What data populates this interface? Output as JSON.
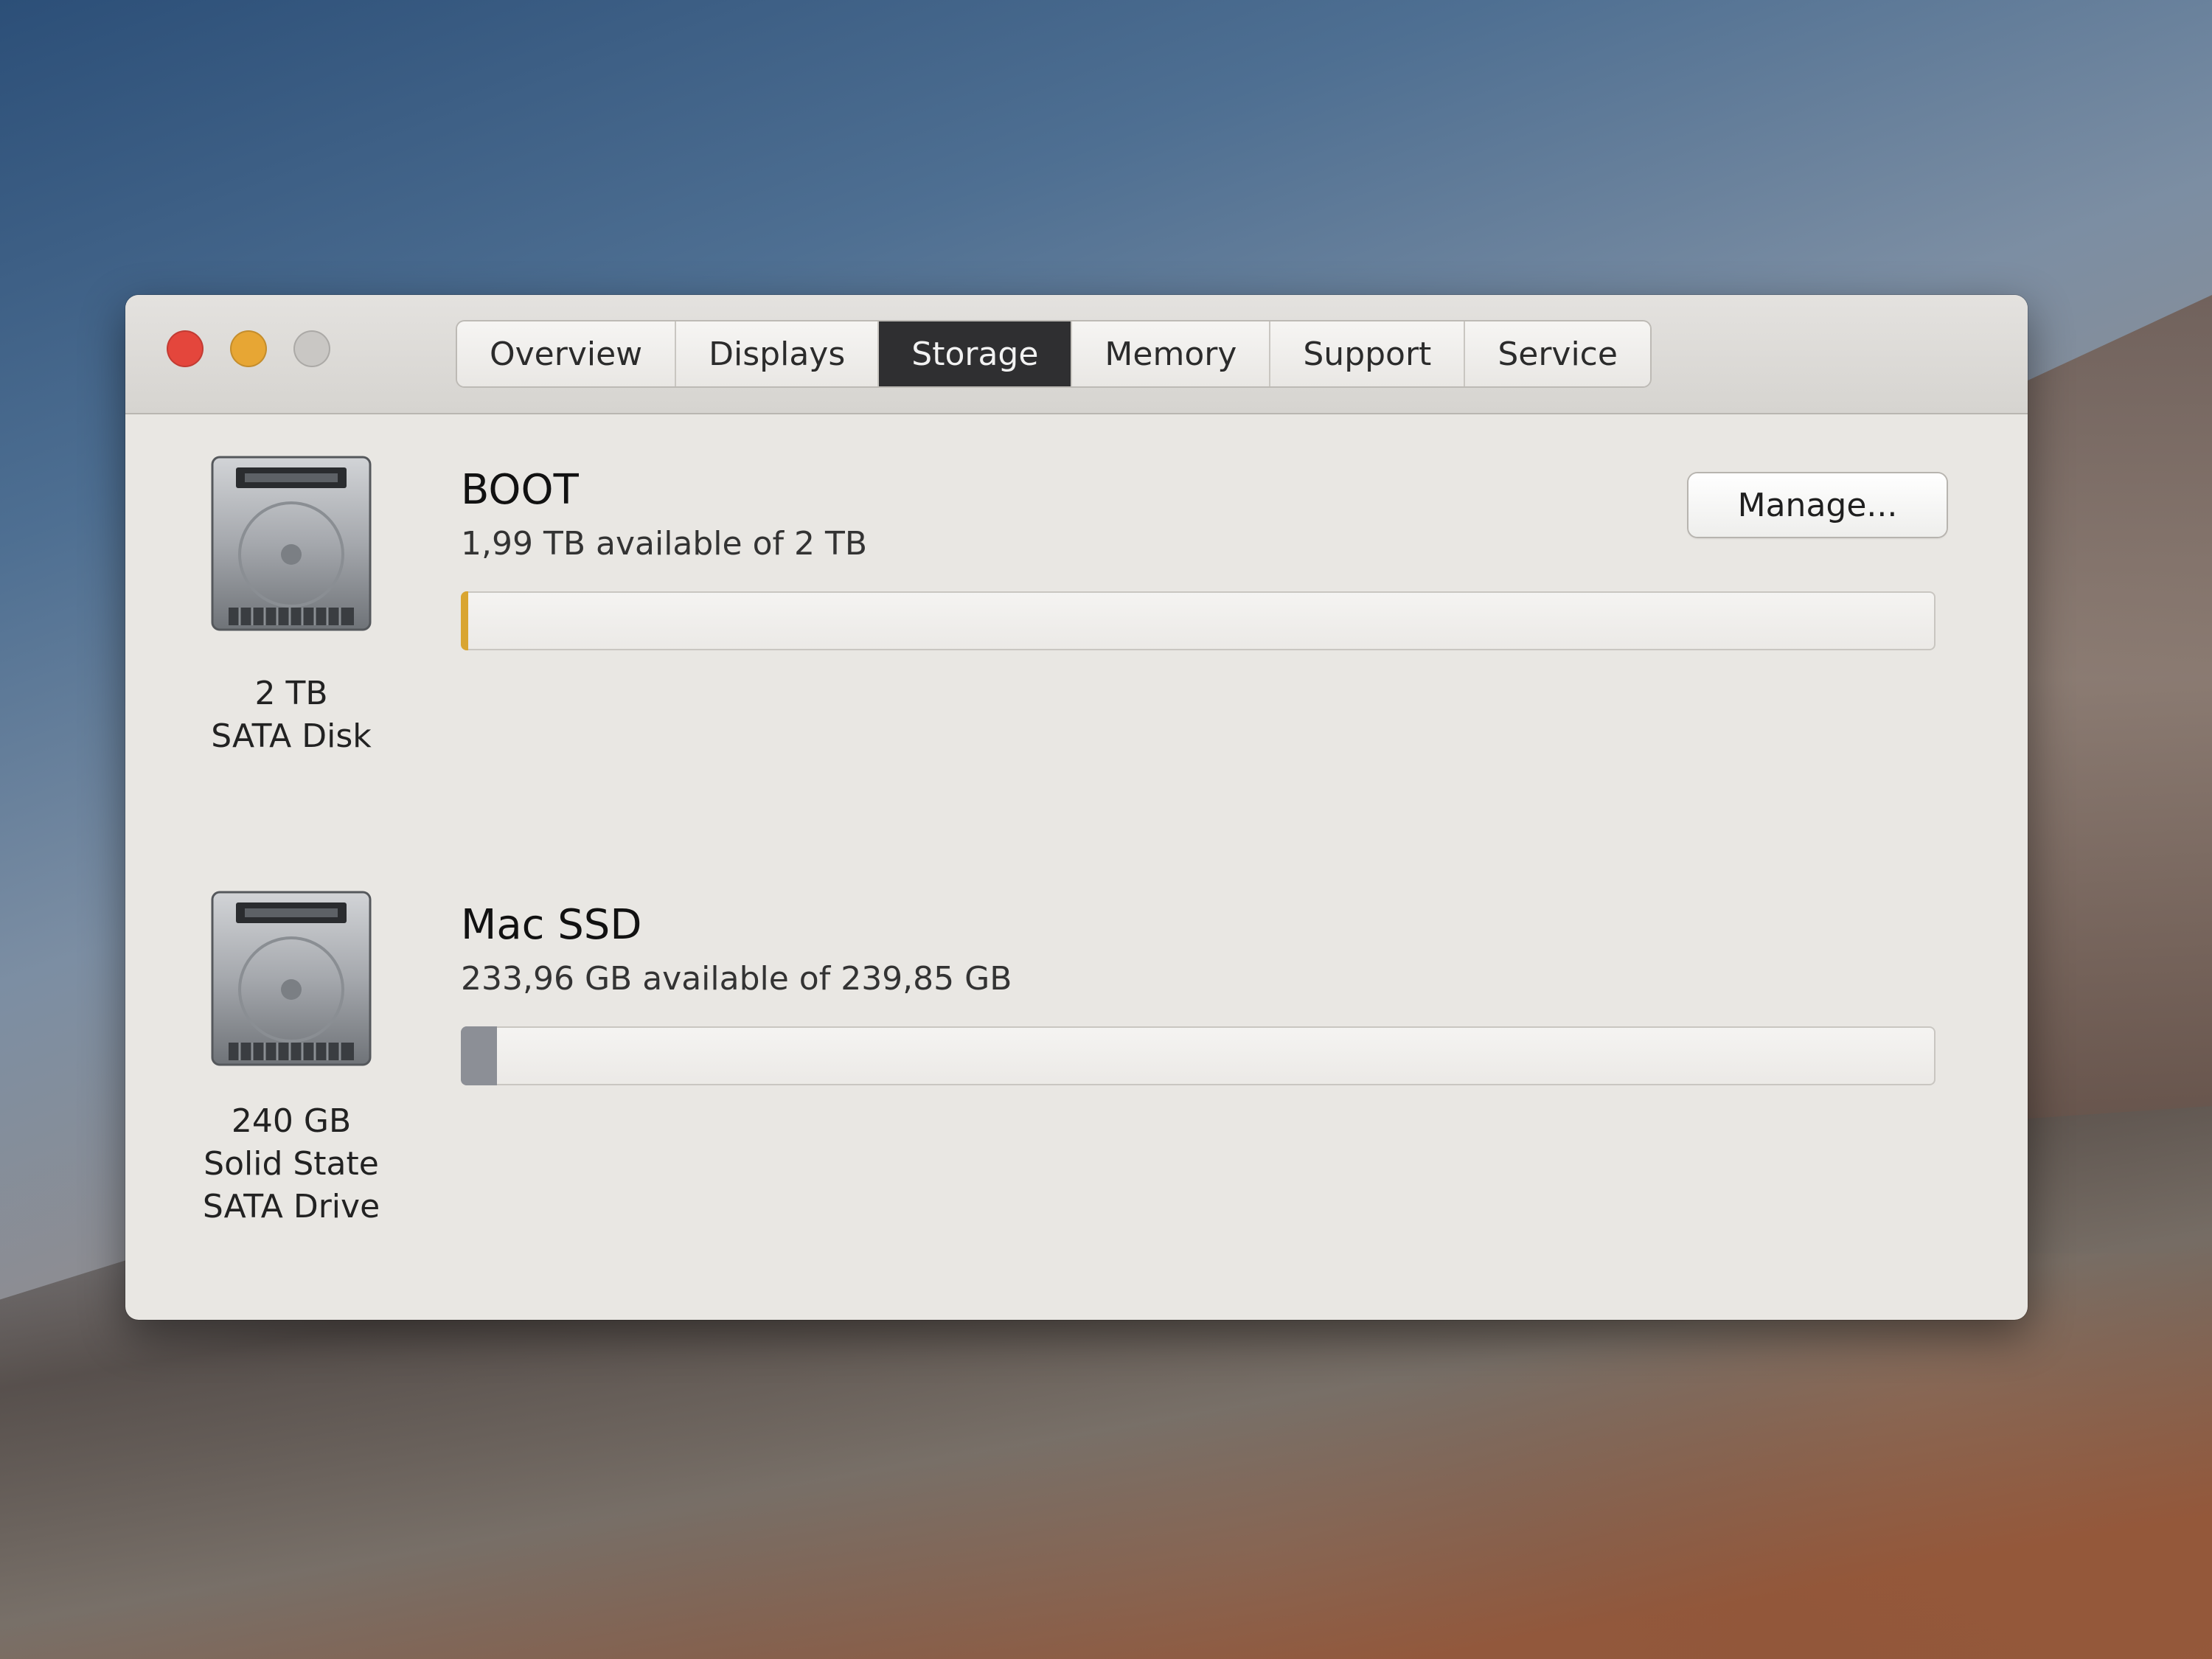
{
  "window": {
    "tabs": [
      {
        "label": "Overview",
        "active": false
      },
      {
        "label": "Displays",
        "active": false
      },
      {
        "label": "Storage",
        "active": true
      },
      {
        "label": "Memory",
        "active": false
      },
      {
        "label": "Support",
        "active": false
      },
      {
        "label": "Service",
        "active": false
      }
    ]
  },
  "drives": [
    {
      "icon": "hard-drive-icon",
      "caption_lines": [
        "2 TB",
        "SATA Disk"
      ],
      "volume_name": "BOOT",
      "availability": "1,99 TB available of 2 TB",
      "used_fraction": 0.005,
      "bar_color": "#d9a531",
      "manage_label": "Manage..."
    },
    {
      "icon": "hard-drive-icon",
      "caption_lines": [
        "240 GB",
        "Solid State",
        "SATA Drive"
      ],
      "volume_name": "Mac SSD",
      "availability": "233,96 GB available of 239,85 GB",
      "used_fraction": 0.0246,
      "bar_color": "#8c8f96"
    }
  ]
}
